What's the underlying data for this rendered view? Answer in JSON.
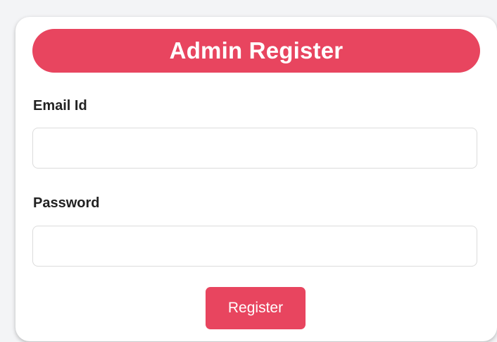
{
  "form": {
    "title": "Admin Register",
    "email_label": "Email Id",
    "email_value": "",
    "password_label": "Password",
    "password_value": "",
    "submit_label": "Register"
  },
  "colors": {
    "accent": "#e8455f",
    "card_background": "#ffffff",
    "input_border": "#dcdcdc",
    "label_text": "#222222"
  }
}
